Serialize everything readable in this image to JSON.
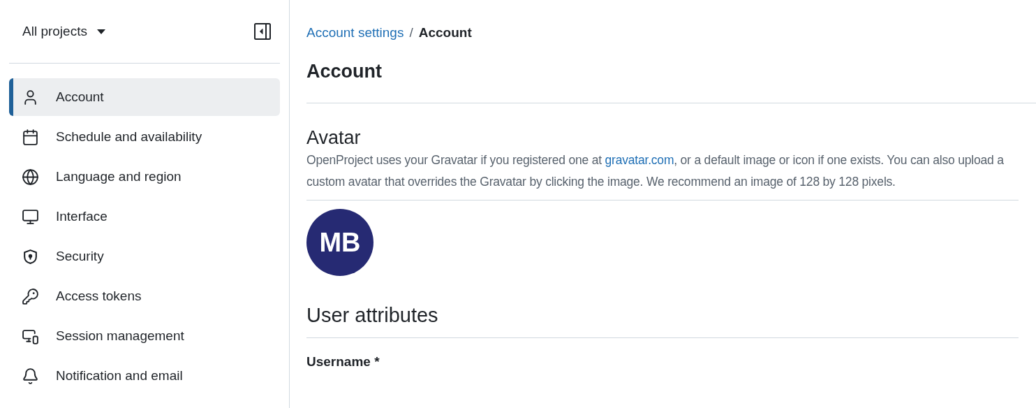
{
  "sidebar": {
    "project_selector": "All projects",
    "items": [
      {
        "label": "Account",
        "selected": true
      },
      {
        "label": "Schedule and availability",
        "selected": false
      },
      {
        "label": "Language and region",
        "selected": false
      },
      {
        "label": "Interface",
        "selected": false
      },
      {
        "label": "Security",
        "selected": false
      },
      {
        "label": "Access tokens",
        "selected": false
      },
      {
        "label": "Session management",
        "selected": false
      },
      {
        "label": "Notification and email",
        "selected": false
      }
    ]
  },
  "breadcrumb": {
    "parent": "Account settings",
    "separator": "/",
    "current": "Account"
  },
  "page_title": "Account",
  "avatar_section": {
    "title": "Avatar",
    "description_before": "OpenProject uses your Gravatar if you registered one at ",
    "link": "gravatar.com",
    "description_after": ", or a default image or icon if one exists. You can also upload a custom avatar that overrides the Gravatar by clicking the image. We recommend an image of 128 by 128 pixels.",
    "initials": "MB"
  },
  "user_attributes": {
    "title": "User attributes",
    "field_label": "Username *"
  }
}
